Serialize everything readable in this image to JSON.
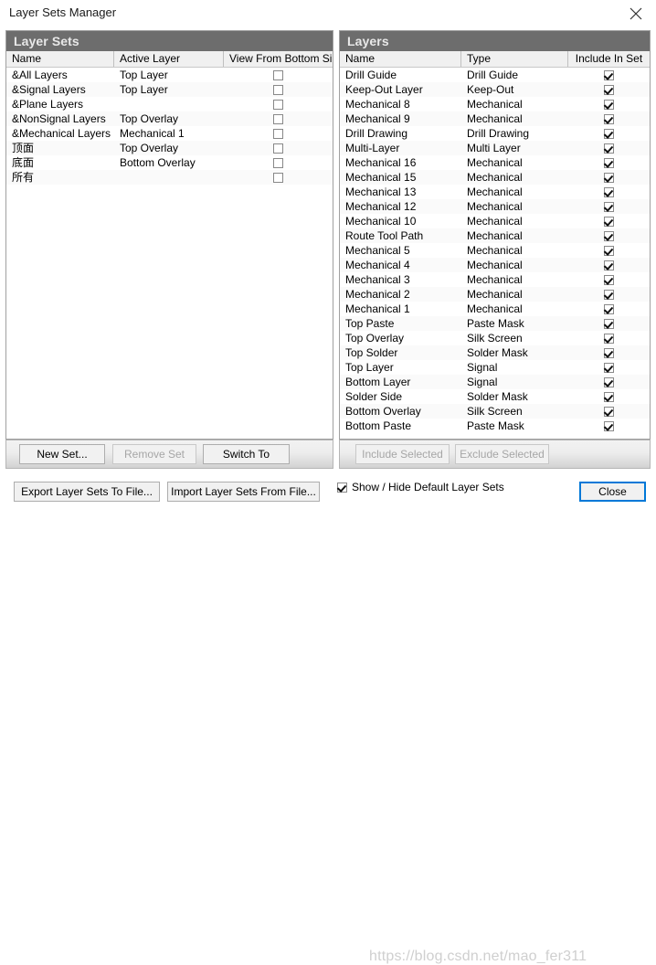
{
  "window": {
    "title": "Layer Sets Manager",
    "close_icon": "close-icon"
  },
  "left_panel": {
    "header": "Layer Sets",
    "columns": [
      "Name",
      "Active Layer",
      "View From Bottom Side"
    ],
    "rows": [
      {
        "name": "&All Layers",
        "active_layer": "Top Layer",
        "view_from_bottom": false
      },
      {
        "name": "&Signal Layers",
        "active_layer": "Top Layer",
        "view_from_bottom": false
      },
      {
        "name": "&Plane Layers",
        "active_layer": "",
        "view_from_bottom": false
      },
      {
        "name": "&NonSignal Layers",
        "active_layer": "Top Overlay",
        "view_from_bottom": false
      },
      {
        "name": "&Mechanical Layers",
        "active_layer": "Mechanical 1",
        "view_from_bottom": false
      },
      {
        "name": "顶面",
        "active_layer": "Top Overlay",
        "view_from_bottom": false
      },
      {
        "name": "底面",
        "active_layer": "Bottom Overlay",
        "view_from_bottom": false
      },
      {
        "name": "所有",
        "active_layer": "",
        "view_from_bottom": false
      }
    ],
    "buttons": [
      {
        "label": "New Set...",
        "enabled": true
      },
      {
        "label": "Remove Set",
        "enabled": false
      },
      {
        "label": "Switch To",
        "enabled": true
      }
    ]
  },
  "right_panel": {
    "header": "Layers",
    "columns": [
      "Name",
      "Type",
      "Include In Set"
    ],
    "rows": [
      {
        "name": "Drill Guide",
        "type": "Drill Guide",
        "included": true
      },
      {
        "name": "Keep-Out Layer",
        "type": "Keep-Out",
        "included": true
      },
      {
        "name": "Mechanical 8",
        "type": "Mechanical",
        "included": true
      },
      {
        "name": "Mechanical 9",
        "type": "Mechanical",
        "included": true
      },
      {
        "name": "Drill Drawing",
        "type": "Drill Drawing",
        "included": true
      },
      {
        "name": "Multi-Layer",
        "type": "Multi Layer",
        "included": true
      },
      {
        "name": "Mechanical 16",
        "type": "Mechanical",
        "included": true
      },
      {
        "name": "Mechanical 15",
        "type": "Mechanical",
        "included": true
      },
      {
        "name": "Mechanical 13",
        "type": "Mechanical",
        "included": true
      },
      {
        "name": "Mechanical 12",
        "type": "Mechanical",
        "included": true
      },
      {
        "name": "Mechanical 10",
        "type": "Mechanical",
        "included": true
      },
      {
        "name": "Route Tool Path",
        "type": "Mechanical",
        "included": true
      },
      {
        "name": "Mechanical 5",
        "type": "Mechanical",
        "included": true
      },
      {
        "name": "Mechanical 4",
        "type": "Mechanical",
        "included": true
      },
      {
        "name": "Mechanical 3",
        "type": "Mechanical",
        "included": true
      },
      {
        "name": "Mechanical 2",
        "type": "Mechanical",
        "included": true
      },
      {
        "name": "Mechanical 1",
        "type": "Mechanical",
        "included": true
      },
      {
        "name": "Top Paste",
        "type": "Paste Mask",
        "included": true
      },
      {
        "name": "Top Overlay",
        "type": "Silk Screen",
        "included": true
      },
      {
        "name": "Top Solder",
        "type": "Solder Mask",
        "included": true
      },
      {
        "name": "Top Layer",
        "type": "Signal",
        "included": true
      },
      {
        "name": "Bottom Layer",
        "type": "Signal",
        "included": true
      },
      {
        "name": "Solder Side",
        "type": "Solder Mask",
        "included": true
      },
      {
        "name": "Bottom Overlay",
        "type": "Silk Screen",
        "included": true
      },
      {
        "name": "Bottom Paste",
        "type": "Paste Mask",
        "included": true
      }
    ],
    "buttons": [
      {
        "label": "Include Selected",
        "enabled": false
      },
      {
        "label": "Exclude Selected",
        "enabled": false
      }
    ]
  },
  "footer": {
    "export_button": "Export Layer Sets To File...",
    "import_button": "Import Layer Sets From File...",
    "show_hide_label": "Show / Hide Default Layer Sets",
    "show_hide_checked": true,
    "close_button": "Close",
    "watermark": "https://blog.csdn.net/mao_fer311"
  },
  "colors": {
    "panel_header_bg": "#6d6d6d",
    "panel_header_text": "#e8e8e8",
    "column_header_bg": "#f0f0f0",
    "row_alt_bg": "#fafafa",
    "focus_accent": "#0078d7",
    "disabled_text": "#a6a6a6",
    "watermark": "#cfcfcf"
  }
}
